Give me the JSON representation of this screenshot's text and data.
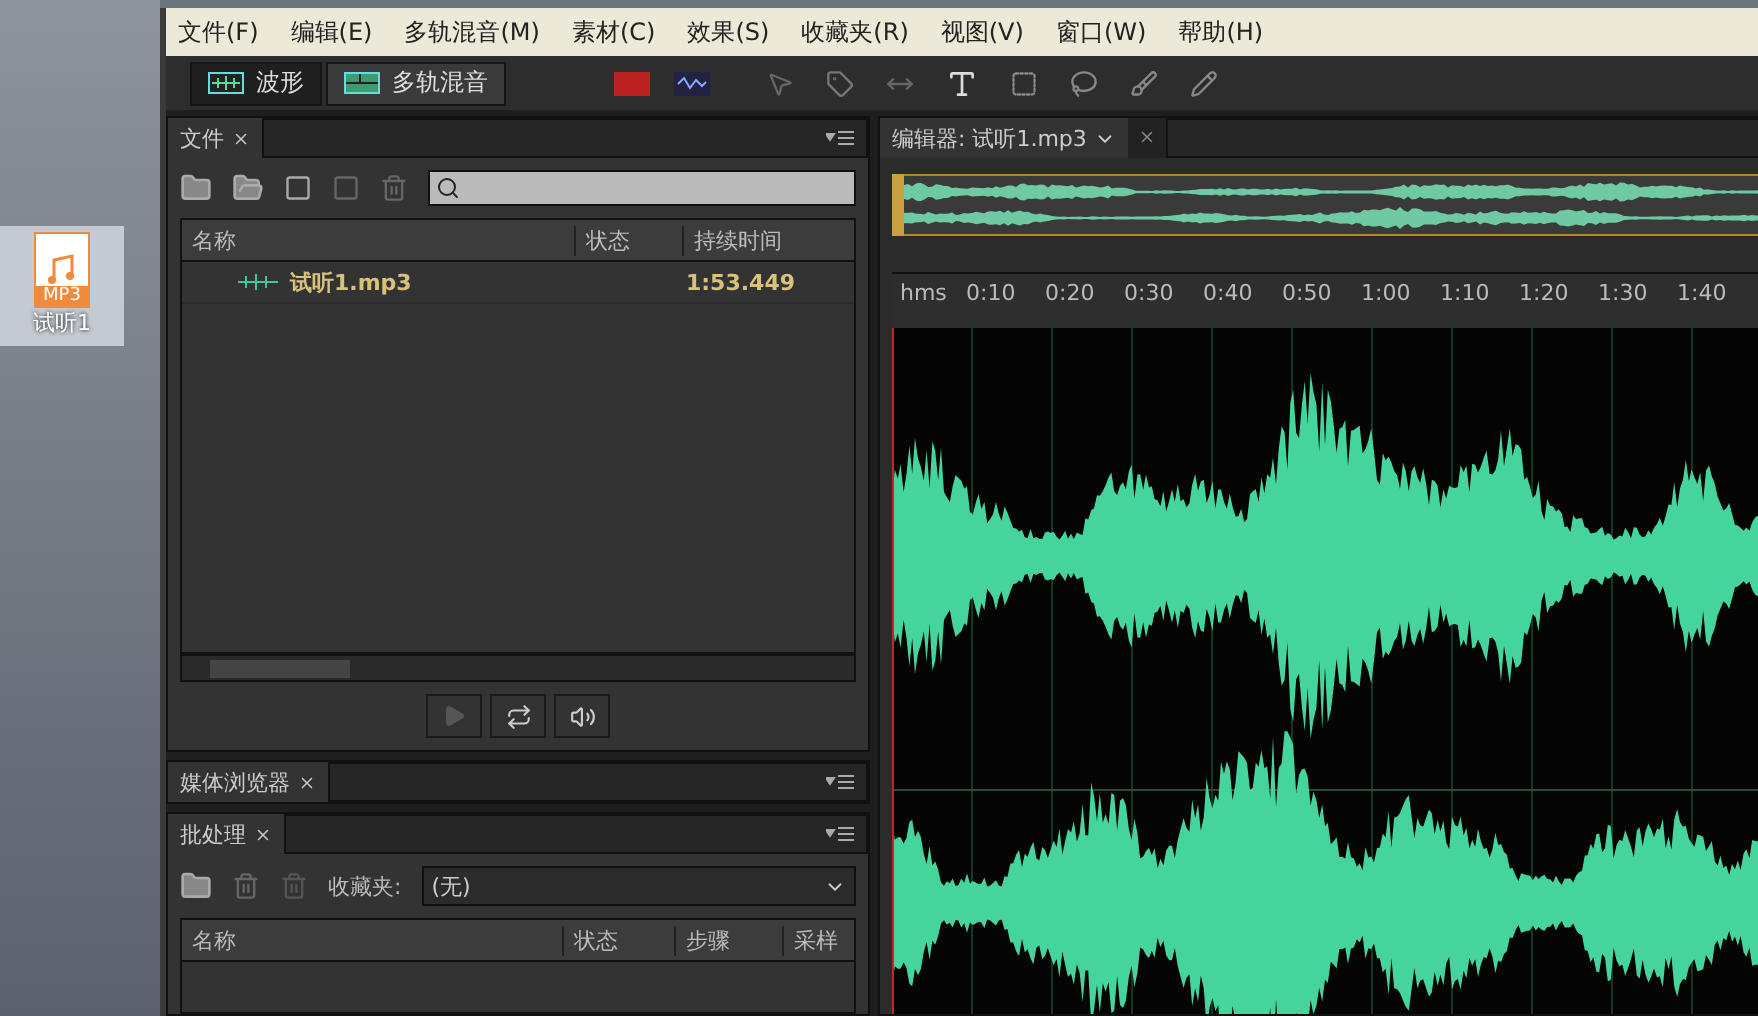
{
  "desktop_icon": {
    "badge": "MP3",
    "label": "试听1"
  },
  "menu": [
    "文件(F)",
    "编辑(E)",
    "多轨混音(M)",
    "素材(C)",
    "效果(S)",
    "收藏夹(R)",
    "视图(V)",
    "窗口(W)",
    "帮助(H)"
  ],
  "toolbar": {
    "modes": [
      {
        "label": "波形",
        "selected": true
      },
      {
        "label": "多轨混音",
        "selected": false
      }
    ]
  },
  "files_panel": {
    "tab": "文件",
    "columns": [
      "名称",
      "状态",
      "持续时间"
    ],
    "rows": [
      {
        "name": "试听1.mp3",
        "duration": "1:53.449",
        "selected": false
      }
    ]
  },
  "media_browser": {
    "tab": "媒体浏览器"
  },
  "batch_panel": {
    "tab": "批处理",
    "favorites_label": "收藏夹:",
    "favorites_value": "(无)",
    "columns": [
      "名称",
      "状态",
      "步骤",
      "采样"
    ]
  },
  "editor": {
    "tab": "编辑器: 试听1.mp3",
    "ruler_unit": "hms",
    "ticks": [
      "0:10",
      "0:20",
      "0:30",
      "0:40",
      "0:50",
      "1:00",
      "1:10",
      "1:20",
      "1:30",
      "1:40"
    ]
  }
}
